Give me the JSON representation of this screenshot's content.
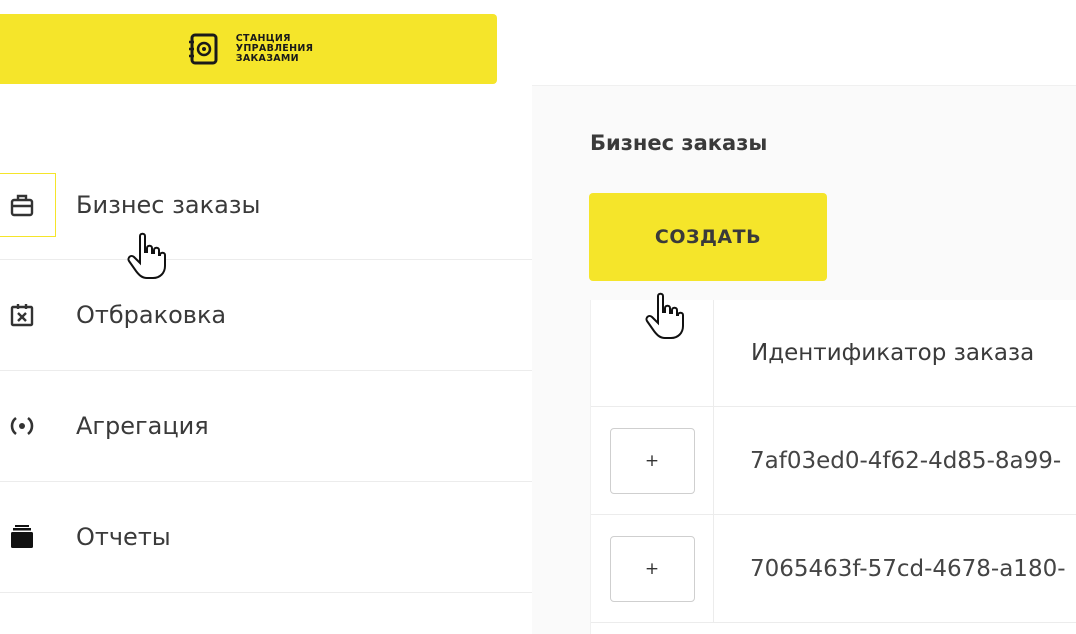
{
  "logo": {
    "line1": "СТАНЦИЯ",
    "line2": "УПРАВЛЕНИЯ",
    "line3": "ЗАКАЗАМИ",
    "icon": "gear-book-icon"
  },
  "sidebar": {
    "items": [
      {
        "label": "Бизнес заказы",
        "icon": "briefcase-icon",
        "active": true
      },
      {
        "label": "Отбраковка",
        "icon": "reject-box-icon",
        "active": false
      },
      {
        "label": "Агрегация",
        "icon": "aggregation-icon",
        "active": false
      },
      {
        "label": "Отчеты",
        "icon": "reports-icon",
        "active": false
      }
    ]
  },
  "main": {
    "title": "Бизнес заказы",
    "create_label": "СОЗДАТЬ",
    "table": {
      "header": "Идентификатор заказа",
      "rows": [
        {
          "expand_label": "+",
          "id": "7af03ed0-4f62-4d85-8a99-"
        },
        {
          "expand_label": "+",
          "id": "7065463f-57cd-4678-a180-"
        }
      ]
    }
  },
  "colors": {
    "accent": "#f5e52a",
    "text": "#3a3a3a",
    "border": "#ececec"
  }
}
